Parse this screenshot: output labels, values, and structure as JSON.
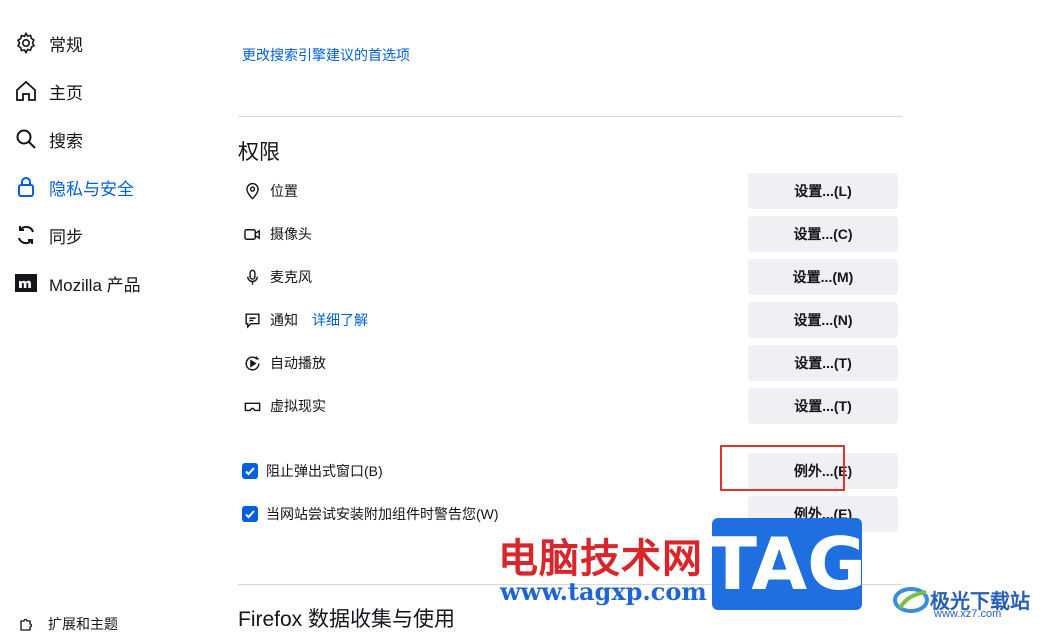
{
  "sidebar": {
    "items": [
      {
        "label": "常规",
        "icon": "gear-icon"
      },
      {
        "label": "主页",
        "icon": "home-icon"
      },
      {
        "label": "搜索",
        "icon": "search-icon"
      },
      {
        "label": "隐私与安全",
        "icon": "lock-icon",
        "active": true
      },
      {
        "label": "同步",
        "icon": "sync-icon"
      },
      {
        "label": "Mozilla 产品",
        "icon": "mozilla-logo-icon"
      }
    ],
    "extensions_label": "扩展和主题"
  },
  "search_suggestions_link": "更改搜索引擎建议的首选项",
  "permissions": {
    "title": "权限",
    "rows": [
      {
        "label": "位置",
        "icon": "location-pin-icon",
        "button": "设置...(L)"
      },
      {
        "label": "摄像头",
        "icon": "camera-icon",
        "button": "设置...(C)"
      },
      {
        "label": "麦克风",
        "icon": "microphone-icon",
        "button": "设置...(M)"
      },
      {
        "label": "通知",
        "icon": "notification-icon",
        "button": "设置...(N)",
        "link": "详细了解"
      },
      {
        "label": "自动播放",
        "icon": "autoplay-icon",
        "button": "设置...(T)"
      },
      {
        "label": "虚拟现实",
        "icon": "vr-headset-icon",
        "button": "设置...(T)"
      }
    ],
    "checkboxes": [
      {
        "label": "阻止弹出式窗口(B)",
        "checked": true,
        "button": "例外...(E)"
      },
      {
        "label": "当网站尝试安装附加组件时警告您(W)",
        "checked": true,
        "button": "例外...(E)"
      }
    ]
  },
  "data_collection_title": "Firefox 数据收集与使用",
  "watermark": {
    "text": "电脑技术网",
    "url": "www.tagxp.com",
    "badge": "TAG",
    "site_name": "极光下载站",
    "site_url": "www.xz7.com"
  },
  "colors": {
    "accent": "#0061e0",
    "button_bg": "#f0f0f4",
    "highlight": "#e0352b"
  }
}
